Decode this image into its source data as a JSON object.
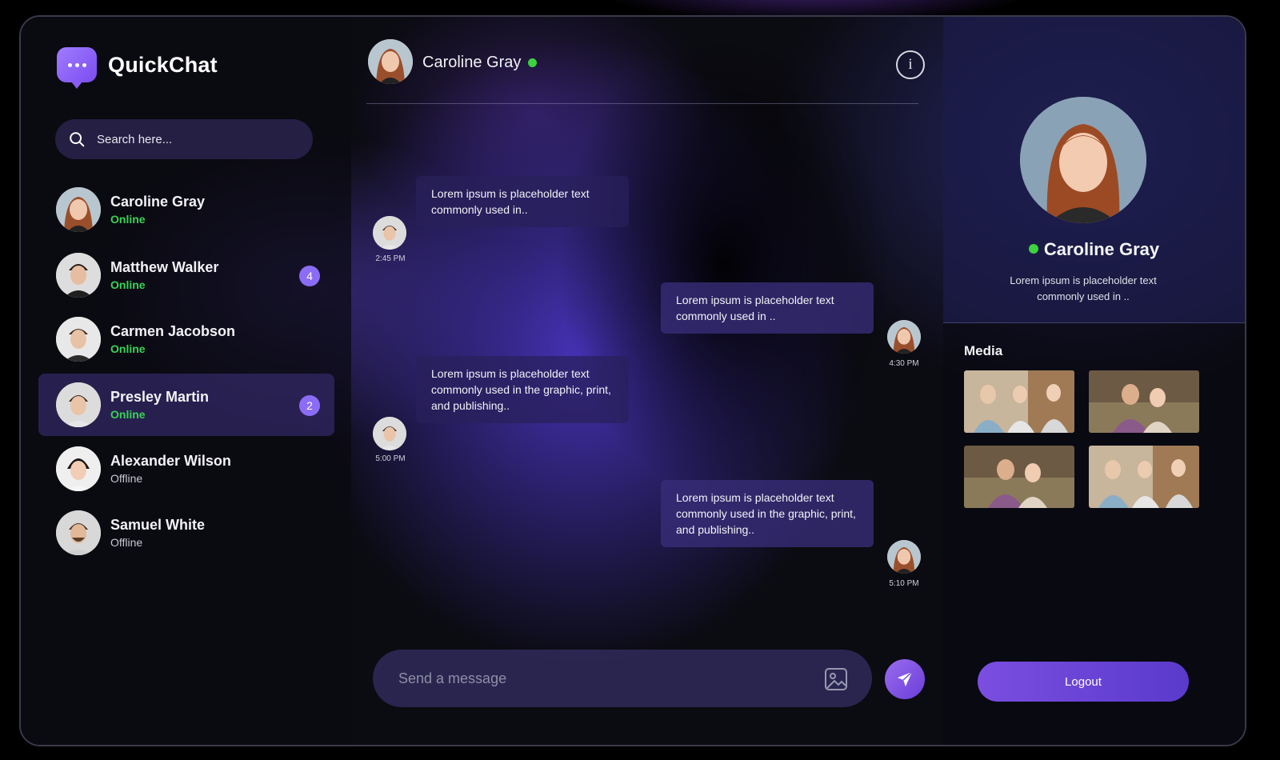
{
  "app": {
    "name": "QuickChat"
  },
  "search": {
    "placeholder": "Search here..."
  },
  "contacts": [
    {
      "name": "Caroline Gray",
      "status": "Online",
      "badge": ""
    },
    {
      "name": "Matthew Walker",
      "status": "Online",
      "badge": "4"
    },
    {
      "name": "Carmen Jacobson",
      "status": "Online",
      "badge": ""
    },
    {
      "name": "Presley Martin",
      "status": "Online",
      "badge": "2"
    },
    {
      "name": "Alexander Wilson",
      "status": "Offline",
      "badge": ""
    },
    {
      "name": "Samuel White",
      "status": "Offline",
      "badge": ""
    }
  ],
  "chat": {
    "contact_name": "Caroline Gray",
    "messages": [
      {
        "text": "Lorem ipsum is placeholder text commonly used in..",
        "time": "2:45 PM"
      },
      {
        "text": "Lorem ipsum is placeholder text commonly used in ..",
        "time": "4:30 PM"
      },
      {
        "text": "Lorem ipsum is placeholder text commonly used in the graphic, print, and publishing..",
        "time": "5:00 PM"
      },
      {
        "text": "Lorem ipsum is placeholder text commonly used in the graphic, print, and publishing..",
        "time": "5:10 PM"
      }
    ],
    "composer_placeholder": "Send a message"
  },
  "profile": {
    "name": "Caroline Gray",
    "bio": "Lorem ipsum is placeholder text commonly used in ..",
    "media_label": "Media",
    "logout_label": "Logout"
  },
  "colors": {
    "accent": "#8b6cf6",
    "online": "#39d353",
    "background": "#0b0b12"
  },
  "icons": [
    "chat-bubble-icon",
    "search-icon",
    "info-icon",
    "image-icon",
    "send-icon"
  ]
}
